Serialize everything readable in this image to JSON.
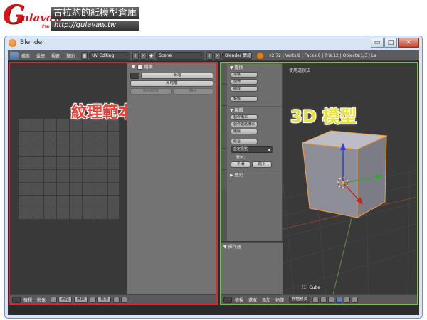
{
  "watermark": {
    "logo_text": "Gulavaw.tw",
    "name": "古拉豹的紙模型倉庫",
    "url": "http://gulavaw.tw"
  },
  "window": {
    "title": "Blender",
    "buttons": {
      "minimize": "▭",
      "maximize": "□",
      "close": "✕"
    }
  },
  "topbar": {
    "menus": [
      "檔案",
      "彙總",
      "視窗",
      "幫助"
    ],
    "screen_layout": "UV Editing",
    "scene": "Scene",
    "engine": "Blender 算繪",
    "stats": "v2.72 | Verts:8 | Faces:6 | Tris:12 | Objects:1/3 | La"
  },
  "uv_editor": {
    "overlay_label": "紋理範本",
    "panel": {
      "header": "檔案",
      "new_button": "新增",
      "new_layer_button": "新增層",
      "remove_button": "刪除紋理",
      "save_button": "轉存"
    },
    "header": {
      "menus": [
        "檢視",
        "影像"
      ],
      "new_button": "新增",
      "open_button": "開啟",
      "view_dropdown": "檢視"
    }
  },
  "view3d": {
    "overlay_label": "3D 模型",
    "view_title": "使用透視法",
    "selected_object": "(1) Cube",
    "toolshelf": {
      "transform_header": "變換",
      "transform_buttons": [
        "平移",
        "旋轉",
        "縮放",
        "鏡像"
      ],
      "edit_header": "編輯",
      "edit_buttons": [
        "製作備本",
        "製作連結備本",
        "刪除"
      ],
      "join_button": "結合",
      "origin_dropdown": "設定原點",
      "shading_label": "著色：",
      "smooth_button": "平滑",
      "flat_button": "扁平",
      "history_header": "歷史",
      "operator_header": "操作器"
    },
    "header": {
      "menus": [
        "檢視",
        "選取",
        "添加",
        "物體"
      ],
      "mode": "物體模式"
    }
  },
  "colors": {
    "uv_highlight": "#e2242a",
    "view_highlight": "#7ac143",
    "uv_label": "#f03c34",
    "view_label": "#e8e23a"
  }
}
